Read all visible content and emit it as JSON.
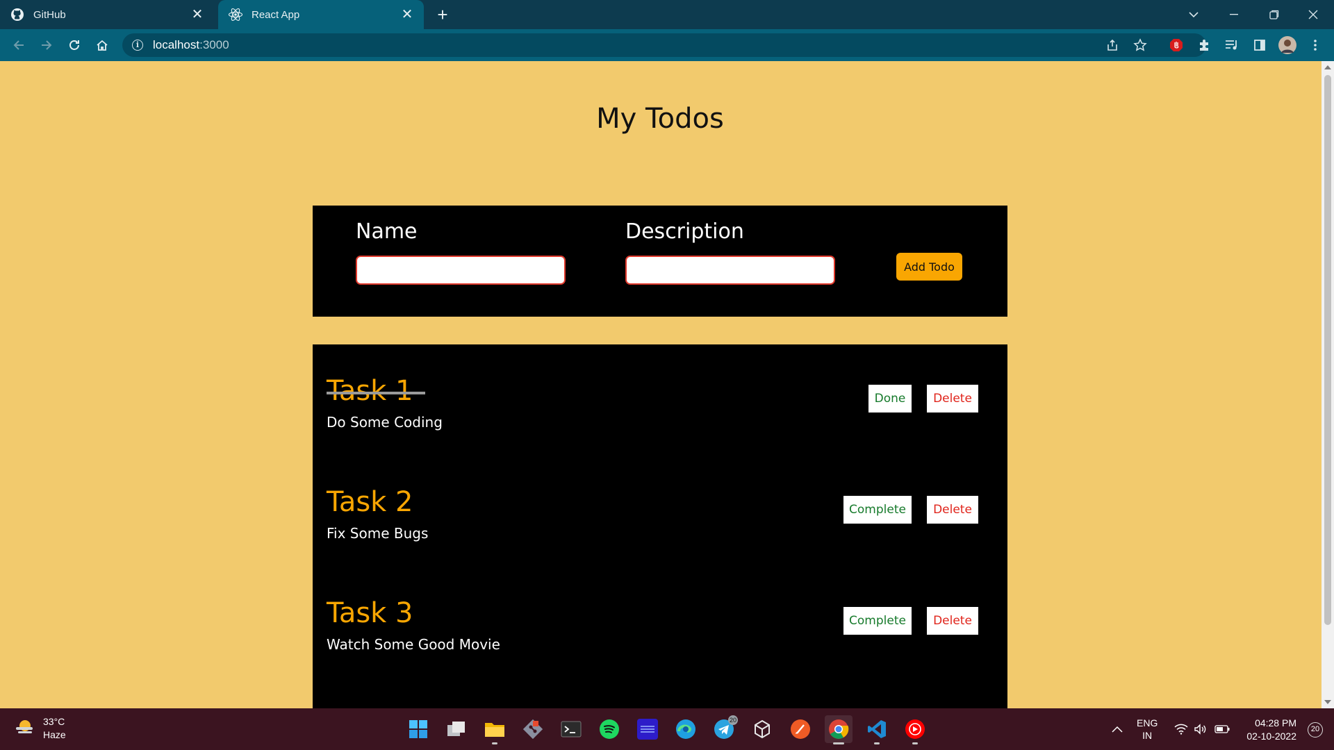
{
  "browser": {
    "tabs": [
      {
        "title": "GitHub",
        "icon": "github-icon",
        "active": false
      },
      {
        "title": "React App",
        "icon": "react-icon",
        "active": true
      }
    ],
    "url_host": "localhost",
    "url_port": ":3000"
  },
  "page": {
    "title": "My Todos",
    "form": {
      "name_label": "Name",
      "name_value": "",
      "description_label": "Description",
      "description_value": "",
      "add_label": "Add Todo"
    },
    "todos": [
      {
        "name": "Task 1",
        "description": "Do Some Coding",
        "completed": true,
        "status_button": "Done",
        "delete_button": "Delete"
      },
      {
        "name": "Task 2",
        "description": "Fix Some Bugs",
        "completed": false,
        "status_button": "Complete",
        "delete_button": "Delete"
      },
      {
        "name": "Task 3",
        "description": "Watch Some Good Movie",
        "completed": false,
        "status_button": "Complete",
        "delete_button": "Delete"
      }
    ]
  },
  "colors": {
    "page_background": "#f2ca6d",
    "panel": "#000000",
    "accent": "#f9a602",
    "complete_text": "#167a2b",
    "delete_text": "#e0241b"
  },
  "taskbar": {
    "weather_temp": "33°C",
    "weather_text": "Haze",
    "telegram_badge": "20",
    "language_line1": "ENG",
    "language_line2": "IN",
    "time": "04:28 PM",
    "date": "02-10-2022",
    "notifications": "20",
    "apps": [
      "windows-start-icon",
      "task-view-icon",
      "file-explorer-icon",
      "git-icon",
      "terminal-icon",
      "spotify-icon",
      "amazon-music-icon",
      "edge-icon",
      "telegram-icon",
      "unity-icon",
      "postman-icon",
      "chrome-icon",
      "vscode-icon",
      "youtube-music-icon"
    ]
  }
}
